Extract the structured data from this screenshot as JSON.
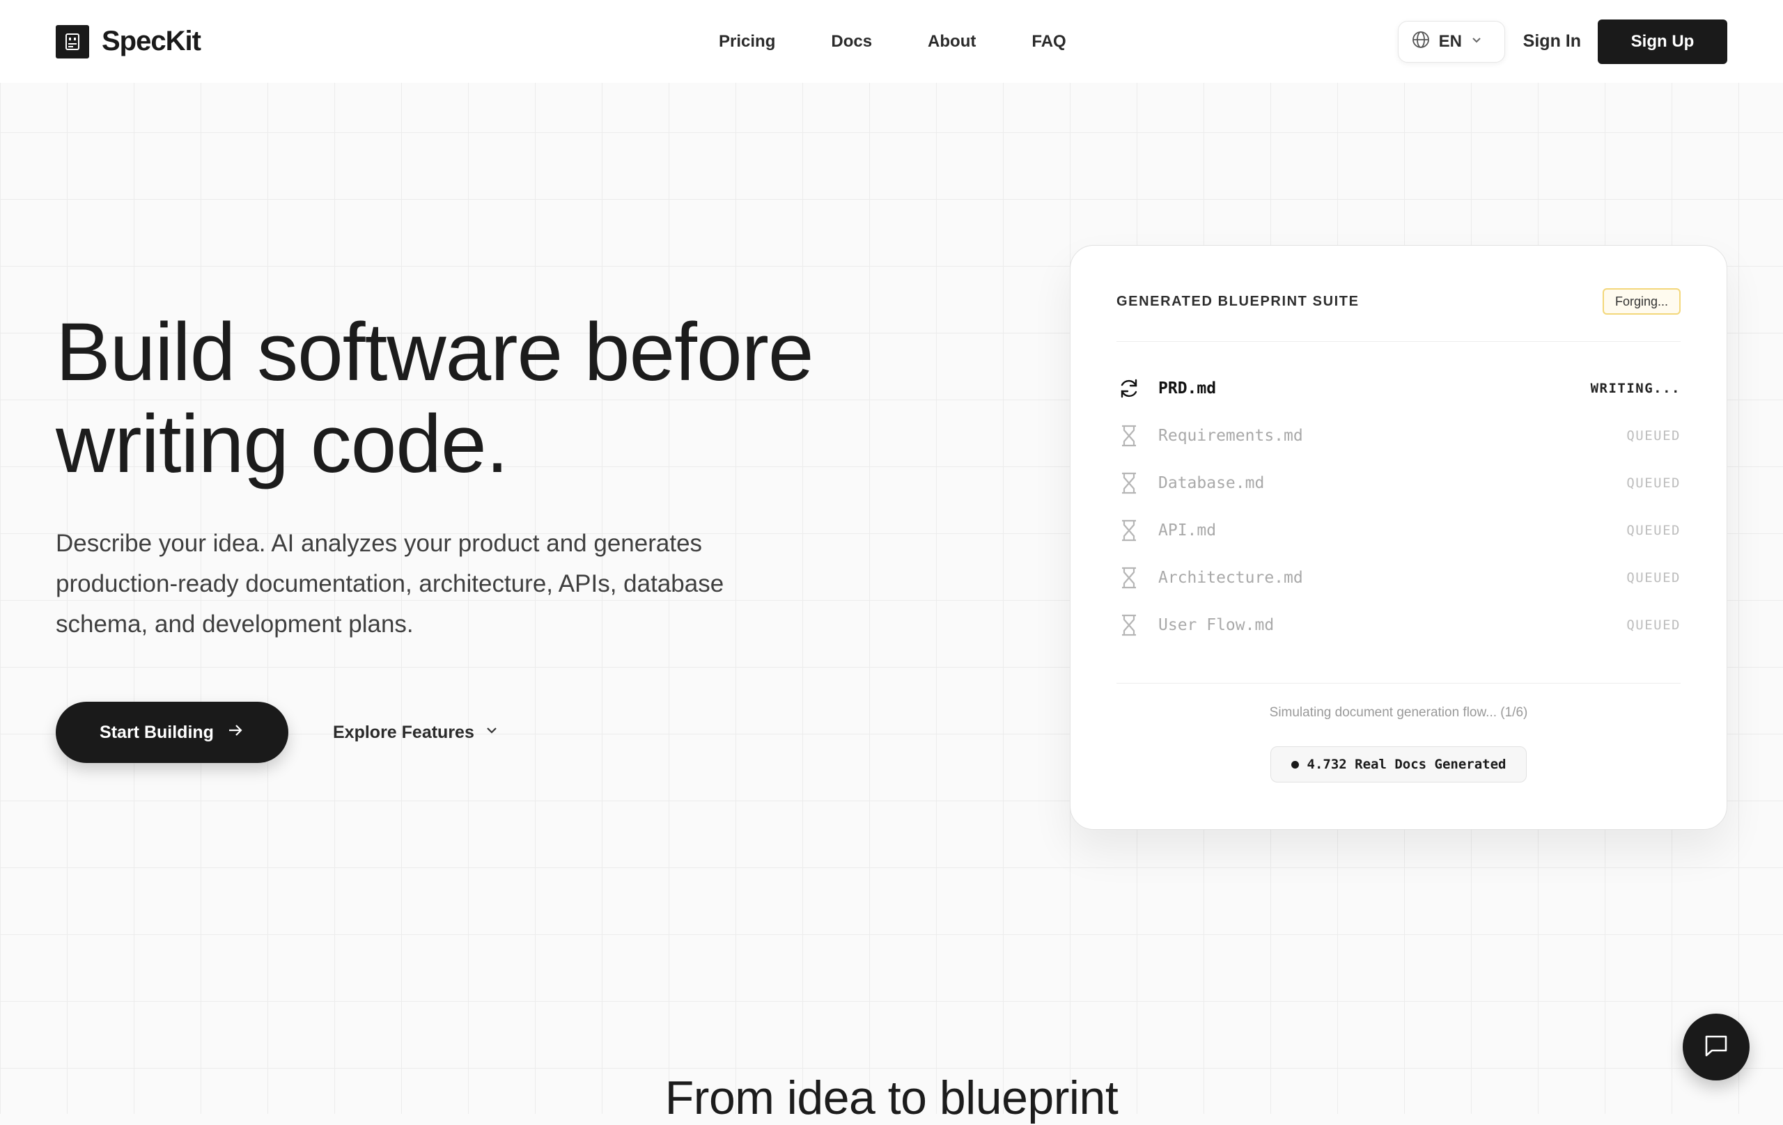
{
  "header": {
    "brand": "SpecKit",
    "nav": [
      "Pricing",
      "Docs",
      "About",
      "FAQ"
    ],
    "language": "EN",
    "sign_in": "Sign In",
    "sign_up": "Sign Up"
  },
  "hero": {
    "title_line1": "Build software before",
    "title_line2": "writing code.",
    "description": "Describe your idea. AI analyzes your product and generates production-ready documentation, architecture, APIs, database schema, and development plans.",
    "cta_primary": "Start Building",
    "cta_secondary": "Explore Features"
  },
  "blueprint": {
    "title": "GENERATED BLUEPRINT SUITE",
    "badge": "Forging...",
    "documents": [
      {
        "name": "PRD.md",
        "status": "WRITING...",
        "icon": "refresh-icon"
      },
      {
        "name": "Requirements.md",
        "status": "QUEUED",
        "icon": "hourglass-icon"
      },
      {
        "name": "Database.md",
        "status": "QUEUED",
        "icon": "hourglass-icon"
      },
      {
        "name": "API.md",
        "status": "QUEUED",
        "icon": "hourglass-icon"
      },
      {
        "name": "Architecture.md",
        "status": "QUEUED",
        "icon": "hourglass-icon"
      },
      {
        "name": "User Flow.md",
        "status": "QUEUED",
        "icon": "hourglass-icon"
      }
    ],
    "footer_text": "Simulating document generation flow... (1/6)",
    "counter": "4.732 Real Docs Generated"
  },
  "section": {
    "title": "From idea to blueprint"
  },
  "colors": {
    "primary": "#1a1a1a",
    "background": "#fafafa",
    "badge_border": "#f3d77a",
    "badge_bg": "#fffbef"
  }
}
